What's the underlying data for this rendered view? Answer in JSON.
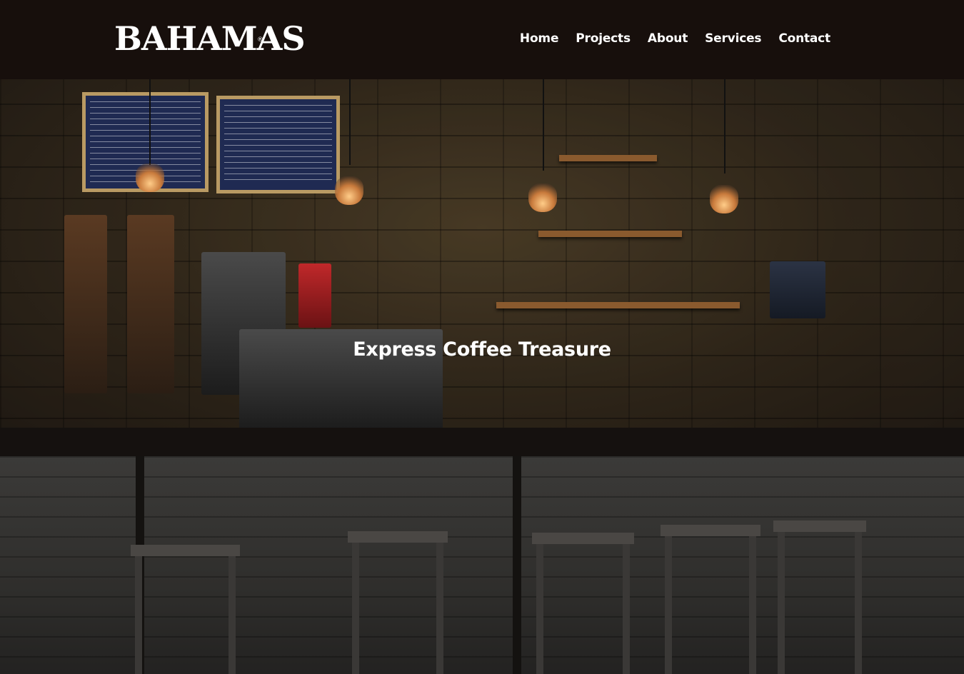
{
  "header": {
    "logo_text": "BAHAMAS",
    "logo_reg": "®",
    "nav": [
      {
        "label": "Home"
      },
      {
        "label": "Projects"
      },
      {
        "label": "About"
      },
      {
        "label": "Services"
      },
      {
        "label": "Contact"
      }
    ]
  },
  "hero": {
    "title": "Express Coffee Treasure",
    "image_desc_icon": "coffee-bar-background"
  },
  "colors": {
    "header_bg": "#170f0c",
    "nav_text": "#ffffff",
    "hero_title": "#ffffff"
  }
}
